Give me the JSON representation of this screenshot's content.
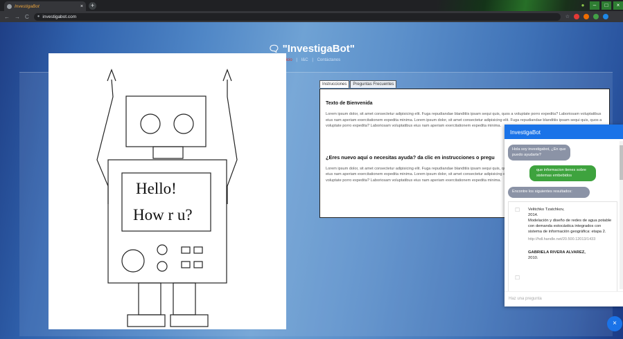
{
  "browser": {
    "tab_title": "InvestigaBot",
    "tab_close": "×",
    "new_tab": "+",
    "nav_back": "←",
    "nav_forward": "→",
    "nav_reload": "C",
    "url": "investigabot.com",
    "win_min": "–",
    "win_max": "□",
    "win_close": "×",
    "star": "☆"
  },
  "site": {
    "title": "\"InvestigaBot\"",
    "nav": {
      "home": "Inicio",
      "sep1": "|",
      "ric": "I&C",
      "sep2": "|",
      "contact": "Contáctanos"
    }
  },
  "robot": {
    "line1": "Hello!",
    "line2": "How r u?"
  },
  "tabs": [
    {
      "label": "Instrucciones"
    },
    {
      "label": "Preguntas Frecuentes"
    }
  ],
  "panel": {
    "heading1": "Texto de Bienvenida",
    "para1": "Lorem ipsum dolor, sit amet consectetur adipisicing elit. Fuga repudiandae blanditiis ipsam sequi quis, quos a voluptate porro expedita? Laboriosam voluptatibus eius nam aperiam exercitationem expedita minima. Lorem ipsum dolor, sit amet consectetur adipisicing elit. Fuga repudiandae blanditiis ipsam sequi quis, quos a voluptate porro expedita? Laboriosam voluptatibus eius nam aperiam exercitationem expedita minima.",
    "heading2": "¿Eres nuevo aquí o necesitas ayuda? da clic en instrucciones o pregu",
    "para2": "Lorem ipsum dolor, sit amet consectetur adipisicing elit. Fuga repudiandae blanditiis ipsam sequi quis, quos a voluptate porro expedita? Laboriosam voluptatibus eius nam aperiam exercitationem expedita minima. Lorem ipsum dolor, sit amet consectetur adipisicing elit. Fuga repudiandae blanditiis ipsam sequi quis, quos a voluptate porro expedita? Laboriosam voluptatibus eius nam aperiam exercitationem expedita minima."
  },
  "chat": {
    "header": "InvestigaBot",
    "bot_greeting": "Hola soy investigabot, ¿En que puedo ayudarte?",
    "user_msg": "que informacion tienes sobre sistemas embebidos",
    "bot_found": "Encontre los siguientes resultados:",
    "result1": {
      "author": "Velitchko Tzatchkov,",
      "year": "2014.",
      "title": "Modelación y diseño de redes de agua potable con demanda estocástica integrados con sistema de información geográfica: etapa 2.",
      "link": "http://hdl.handle.net/20.500.12013/1433"
    },
    "result2": {
      "author": "GABRIELA RIVERA ALVAREZ,",
      "year": "2010."
    },
    "input_placeholder": "Haz una pregunta",
    "fab": "×"
  }
}
